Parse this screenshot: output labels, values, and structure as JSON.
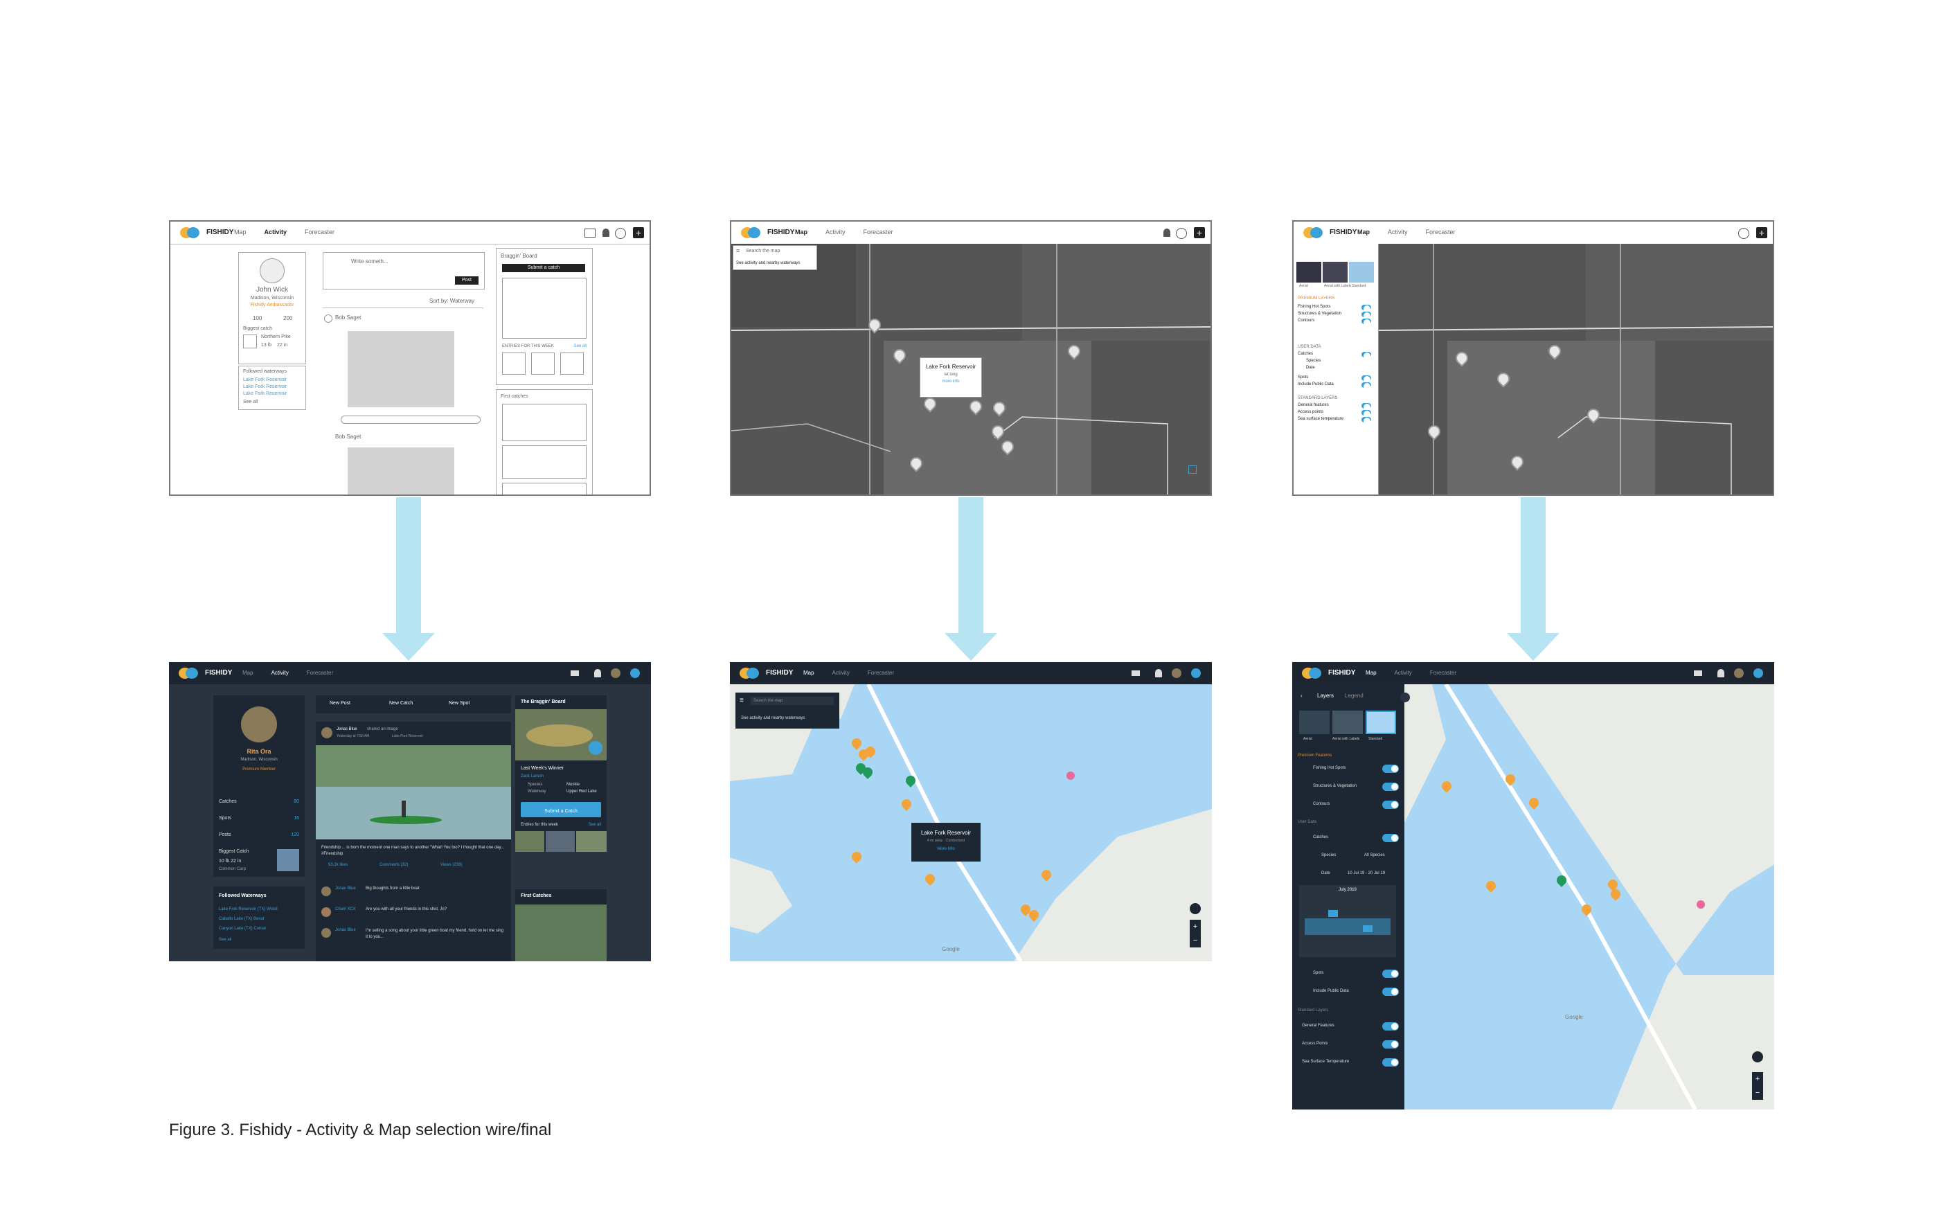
{
  "caption": "Figure 3.  Fishidy - Activity & Map selection wire/final",
  "brand": "FISHIDY",
  "nav": {
    "map": "Map",
    "activity": "Activity",
    "forecaster": "Forecaster"
  },
  "wire_activity": {
    "profile_name": "John Wick",
    "profile_location": "Madison, Wisconsin",
    "profile_badge": "Fishidy Ambassador",
    "count_a": "100",
    "count_b": "200",
    "biggest_catch_label": "Biggest catch",
    "biggest_fish": "Northern Pike",
    "biggest_size": "13 lb    22 in",
    "followed_label": "Followed waterways",
    "followed": [
      "Lake Fork Reservoir",
      "Lake Fork Reservoir",
      "Lake Fork Reservoir"
    ],
    "see_all": "See all",
    "compose_placeholder": "Write someth...",
    "post_button": "Post",
    "sort_label": "Sort by: Waterway",
    "feed_user": "Bob Saget",
    "board_title": "Braggin' Board",
    "submit_catch": "Submit a catch",
    "entries_label": "ENTRIES FOR THIS WEEK",
    "see_all_entries": "See all",
    "first_catches": "First catches"
  },
  "final_activity": {
    "actions": [
      "New Post",
      "New Catch",
      "New Spot"
    ],
    "profile_name": "Rita Ora",
    "profile_location": "Madison, Wisconsin",
    "profile_member": "Premium Member",
    "stats": [
      {
        "label": "Catches",
        "value": "80"
      },
      {
        "label": "Spots",
        "value": "16"
      },
      {
        "label": "Posts",
        "value": "120"
      }
    ],
    "biggest_catch_label": "Biggest Catch",
    "biggest_size": "10 lb  22 in",
    "biggest_species": "Common Carp",
    "followed_title": "Followed Waterways",
    "followed": [
      "Lake Fork Reservoir (TX) Wood",
      "Caballo Lake (TX) Bexar",
      "Canyon Lake (TX) Comal"
    ],
    "see_all": "See all",
    "post_user": "Jonas Blue",
    "post_action": "shared an image",
    "post_time": "Yesterday at 7:58 AM",
    "post_place": "Lake Fork Reservoir",
    "post_text": "Friendship ... is born the moment one man says to another \"What! You too? I thought that one day... #Friendship",
    "post_likes": "93.2k likes",
    "post_comments": "Comments (32)",
    "post_views": "Views (238)",
    "comments": [
      {
        "user": "Jonas Blue",
        "text": "Big thoughts from a little boat"
      },
      {
        "user": "Charli XCX",
        "text": "Are you with all your friends in this shot, Jo?"
      },
      {
        "user": "Jonas Blue",
        "text": "I'm selling a song about your little green boat my friend, hold on let me sing it to you..."
      }
    ],
    "board_title": "The Braggin' Board",
    "winner_label": "Last Week's Winner",
    "winner_name": "Zack Larson",
    "winner_species_label": "Species",
    "winner_species": "Muskie",
    "winner_waterway_label": "Waterway",
    "winner_waterway": "Upper Red Lake",
    "submit_catch": "Submit a Catch",
    "entries_label": "Entries for this week",
    "see_all_entries": "See all",
    "first_catches": "First Catches"
  },
  "wire_map": {
    "search_placeholder": "Search the map",
    "activity_select": "See activity and nearby waterways",
    "popup_title": "Lake Fork Reservoir",
    "popup_sub": "lat long",
    "popup_link": "more info"
  },
  "final_map": {
    "search_placeholder": "Search the map",
    "activity_select": "See activity and nearby waterways",
    "popup_title": "Lake Fork Reservoir",
    "popup_sub": "4 mi away · Cumberland",
    "popup_link": "More Info",
    "google": "Google"
  },
  "wire_layers": {
    "tabs": [
      "Aerial",
      "Aerial with Labels",
      "Standard"
    ],
    "premium_label": "PREMIUM LAYERS",
    "premium": [
      "Fishing Hot Spots",
      "Structures & Vegetation",
      "Contours"
    ],
    "user_label": "USER DATA",
    "user": [
      "Catches",
      "Species",
      "Date",
      "Spots",
      "Include Public Data"
    ],
    "standard_label": "STANDARD LAYERS",
    "standard": [
      "General features",
      "Access points",
      "Sea surface temperature"
    ]
  },
  "final_layers": {
    "tab_layers": "Layers",
    "tab_legend": "Legend",
    "map_types": [
      "Aerial",
      "Aerial with Labels",
      "Standard"
    ],
    "premium_label": "Premium Features",
    "premium": [
      "Fishing Hot Spots",
      "Structures & Vegetation",
      "Contours"
    ],
    "user_label": "User Data",
    "catches": "Catches",
    "species_label": "Species",
    "species_value": "All Species",
    "date_label": "Date",
    "date_value": "10 Jul 19 - 20 Jul 19",
    "calendar_month": "July 2019",
    "spots": "Spots",
    "include_public": "Include Public Data",
    "standard_label": "Standard Layers",
    "standard": [
      "General Features",
      "Access Points",
      "Sea Surface Temperature"
    ],
    "google": "Google"
  },
  "colors": {
    "arrow": "#b7e4f2",
    "accent": "#3aa0d8",
    "pin_orange": "#f2a33a",
    "pin_green": "#1f9a5c"
  }
}
